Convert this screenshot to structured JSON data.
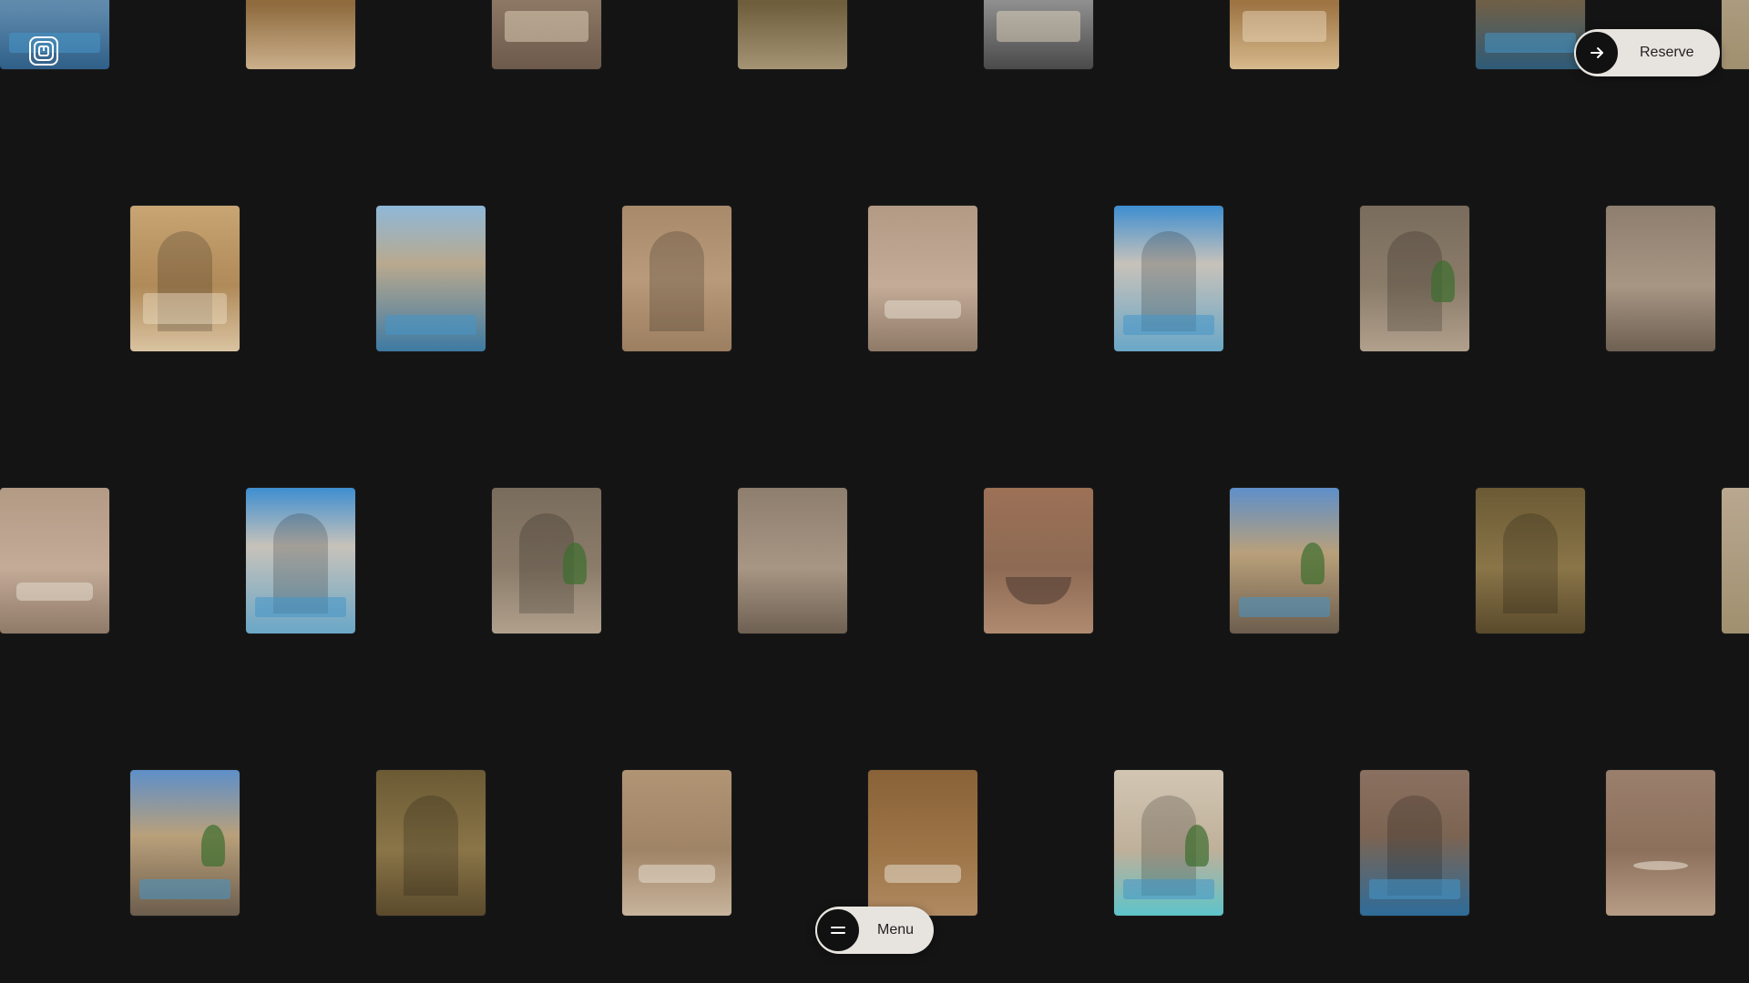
{
  "brand": {
    "logo_icon": "spiral-square-logo-icon"
  },
  "reserve_button": {
    "label": "Reserve",
    "icon": "arrow-right-icon"
  },
  "menu_button": {
    "label": "Menu",
    "icon": "hamburger-icon"
  },
  "colors": {
    "background": "#141414",
    "pill": "#e7e4df",
    "pill_circle": "#111111"
  },
  "gallery": {
    "rows": [
      [
        "pool-bathroom",
        "staircase-vanity",
        "bedroom-neutral",
        "courtyard-columns",
        "bedroom-gray",
        "bedroom-golden",
        "pool-terrace",
        "partial-edge"
      ],
      [
        "bedroom-arched",
        "pool-courtyard",
        "shower-niche",
        "stair-lounge",
        "arch-sky-pool",
        "arch-plant-room",
        "vanity-mirror-shower"
      ],
      [
        "stair-lounge",
        "arch-sky-pool",
        "arch-plant-room",
        "vanity-mirror-shower",
        "bathtub-room",
        "palm-courtyard",
        "arch-corridor",
        "partial-edge"
      ],
      [
        "palm-courtyard",
        "arch-corridor",
        "living-shelves",
        "dome-lounge",
        "cactus-arch",
        "round-portal-pool",
        "dining-room"
      ]
    ]
  }
}
